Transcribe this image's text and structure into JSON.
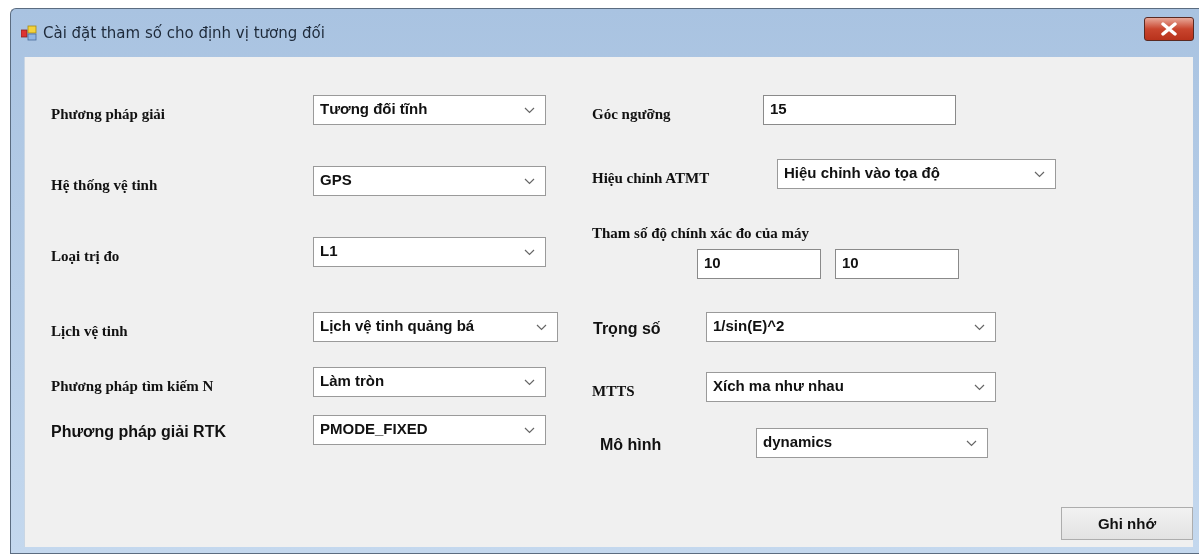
{
  "window": {
    "title": "Cài đặt tham số cho định vị tương đối"
  },
  "left_fields": [
    {
      "kind": "combo",
      "label": "Phương pháp giải",
      "serif": true,
      "value": "Tương đối tĩnh"
    },
    {
      "kind": "combo",
      "label": "Hệ thống vệ tinh",
      "serif": true,
      "value": "GPS"
    },
    {
      "kind": "combo",
      "label": "Loại trị đo",
      "serif": true,
      "value": "L1"
    },
    {
      "kind": "combo",
      "label": "Lịch vệ tinh",
      "serif": true,
      "value": "Lịch vệ tinh quảng bá"
    },
    {
      "kind": "combo",
      "label": "Phương pháp tìm kiếm N",
      "serif": true,
      "value": "Làm tròn"
    },
    {
      "kind": "combo",
      "label": "Phương pháp giải RTK",
      "serif": false,
      "value": "PMODE_FIXED"
    }
  ],
  "right_fields": [
    {
      "kind": "text",
      "label": "Góc ngưỡng",
      "serif": true,
      "value": "15"
    },
    {
      "kind": "combo",
      "label": "Hiệu chỉnh ATMT",
      "serif": true,
      "value": "Hiệu chỉnh vào tọa độ"
    },
    {
      "kind": "pair",
      "label": "Tham số độ chính xác đo của máy",
      "serif": true,
      "values": [
        "10",
        "10"
      ]
    },
    {
      "kind": "combo",
      "label": "Trọng số",
      "serif": false,
      "value": "1/sin(E)^2"
    },
    {
      "kind": "combo",
      "label": "MTTS",
      "serif": true,
      "value": "Xích ma như nhau"
    },
    {
      "kind": "combo",
      "label": "Mô hình",
      "serif": false,
      "value": "dynamics"
    }
  ],
  "buttons": [
    {
      "label": "Ghi nhớ"
    }
  ]
}
